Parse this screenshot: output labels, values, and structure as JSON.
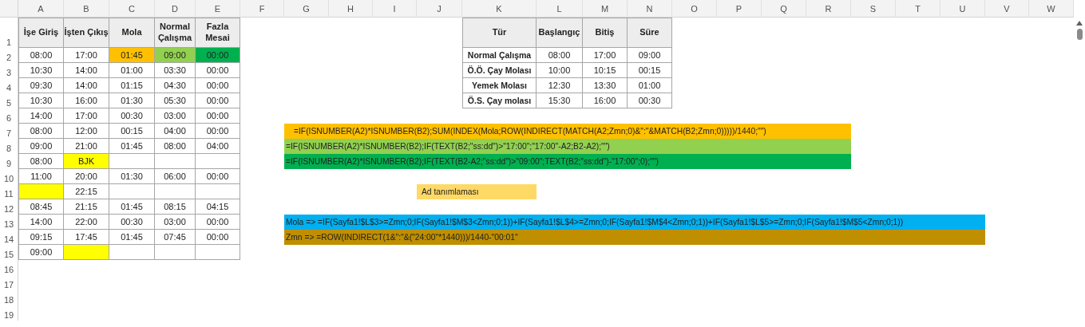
{
  "columns": [
    "A",
    "B",
    "C",
    "D",
    "E",
    "F",
    "G",
    "H",
    "I",
    "J",
    "K",
    "L",
    "M",
    "N",
    "O",
    "P",
    "Q",
    "R",
    "S",
    "T",
    "U",
    "V",
    "W"
  ],
  "rows": [
    "1",
    "2",
    "3",
    "4",
    "5",
    "6",
    "7",
    "8",
    "9",
    "10",
    "11",
    "12",
    "13",
    "14",
    "15",
    "16",
    "17",
    "18",
    "19"
  ],
  "work_table": {
    "columns": [
      "İşe Giriş",
      "İşten Çıkış",
      "Mola",
      "Normal Çalışma",
      "Fazla Mesai"
    ],
    "rows": [
      [
        {
          "value": "08:00"
        },
        {
          "value": "17:00"
        },
        {
          "value": "01:45",
          "color": "#ffc000"
        },
        {
          "value": "09:00",
          "color": "#92d050"
        },
        {
          "value": "00:00",
          "color": "#00b050"
        }
      ],
      [
        {
          "value": "10:30"
        },
        {
          "value": "14:00"
        },
        {
          "value": "01:00"
        },
        {
          "value": "03:30"
        },
        {
          "value": "00:00"
        }
      ],
      [
        {
          "value": "09:30"
        },
        {
          "value": "14:00"
        },
        {
          "value": "01:15"
        },
        {
          "value": "04:30"
        },
        {
          "value": "00:00"
        }
      ],
      [
        {
          "value": "10:30"
        },
        {
          "value": "16:00"
        },
        {
          "value": "01:30"
        },
        {
          "value": "05:30"
        },
        {
          "value": "00:00"
        }
      ],
      [
        {
          "value": "14:00"
        },
        {
          "value": "17:00"
        },
        {
          "value": "00:30"
        },
        {
          "value": "03:00"
        },
        {
          "value": "00:00"
        }
      ],
      [
        {
          "value": "08:00"
        },
        {
          "value": "12:00"
        },
        {
          "value": "00:15"
        },
        {
          "value": "04:00"
        },
        {
          "value": "00:00"
        }
      ],
      [
        {
          "value": "09:00"
        },
        {
          "value": "21:00"
        },
        {
          "value": "01:45"
        },
        {
          "value": "08:00"
        },
        {
          "value": "04:00"
        }
      ],
      [
        {
          "value": "08:00"
        },
        {
          "value": "BJK",
          "color": "#ffff00"
        },
        {},
        {},
        {}
      ],
      [
        {
          "value": "11:00"
        },
        {
          "value": "20:00"
        },
        {
          "value": "01:30"
        },
        {
          "value": "06:00"
        },
        {
          "value": "00:00"
        }
      ],
      [
        {
          "color": "#ffff00"
        },
        {
          "value": "22:15"
        },
        {},
        {},
        {}
      ],
      [
        {
          "value": "08:45"
        },
        {
          "value": "21:15"
        },
        {
          "value": "01:45"
        },
        {
          "value": "08:15"
        },
        {
          "value": "04:15"
        }
      ],
      [
        {
          "value": "14:00"
        },
        {
          "value": "22:00"
        },
        {
          "value": "00:30"
        },
        {
          "value": "03:00"
        },
        {
          "value": "00:00"
        }
      ],
      [
        {
          "value": "09:15"
        },
        {
          "value": "17:45"
        },
        {
          "value": "01:45"
        },
        {
          "value": "07:45"
        },
        {
          "value": "00:00"
        }
      ],
      [
        {
          "value": "09:00"
        },
        {
          "color": "#ffff00"
        },
        {},
        {},
        {}
      ]
    ]
  },
  "reference_table": {
    "columns": [
      "Tür",
      "Başlangıç",
      "Bitiş",
      "Süre"
    ],
    "rows": [
      [
        "Normal Çalışma",
        "08:00",
        "17:00",
        "09:00"
      ],
      [
        "Ö.Ö. Çay Molası",
        "10:00",
        "10:15",
        "00:15"
      ],
      [
        "Yemek Molası",
        "12:30",
        "13:30",
        "01:00"
      ],
      [
        "Ö.S. Çay molası",
        "15:30",
        "16:00",
        "00:30"
      ]
    ]
  },
  "notes": [
    {
      "text": "=IF(ISNUMBER(A2)*ISNUMBER(B2);SUM(INDEX(Mola;ROW(INDIRECT(MATCH(A2;Zmn;0)&\":\"&MATCH(B2;Zmn;0)))))/1440;\"\")",
      "color": "#ffc000"
    },
    {
      "text": "=IF(ISNUMBER(A2)*ISNUMBER(B2);IF(TEXT(B2;\"ss:dd\")>\"17:00\";\"17:00\"-A2;B2-A2);\"\")",
      "color": "#92d050"
    },
    {
      "text": "=IF(ISNUMBER(A2)*ISNUMBER(B2);IF(TEXT(B2-A2;\"ss:dd\")>\"09:00\";TEXT(B2;\"ss:dd\")-\"17:00\";0);\"\")",
      "color": "#00b050"
    },
    {
      "text": "Ad tanımlaması",
      "color": "#ffd966"
    },
    {
      "text": "Mola => =IF(Sayfa1!$L$3>=Zmn;0;IF(Sayfa1!$M$3<Zmn;0;1))+IF(Sayfa1!$L$4>=Zmn;0;IF(Sayfa1!$M$4<Zmn;0;1))+IF(Sayfa1!$L$5>=Zmn;0;IF(Sayfa1!$M$5<Zmn;0;1))",
      "color": "#00b0f0"
    },
    {
      "text": "Zmn => =ROW(INDIRECT(1&\":\"&(\"24:00\"*1440)))/1440-\"00:01\"",
      "color": "#bf8f00"
    }
  ]
}
